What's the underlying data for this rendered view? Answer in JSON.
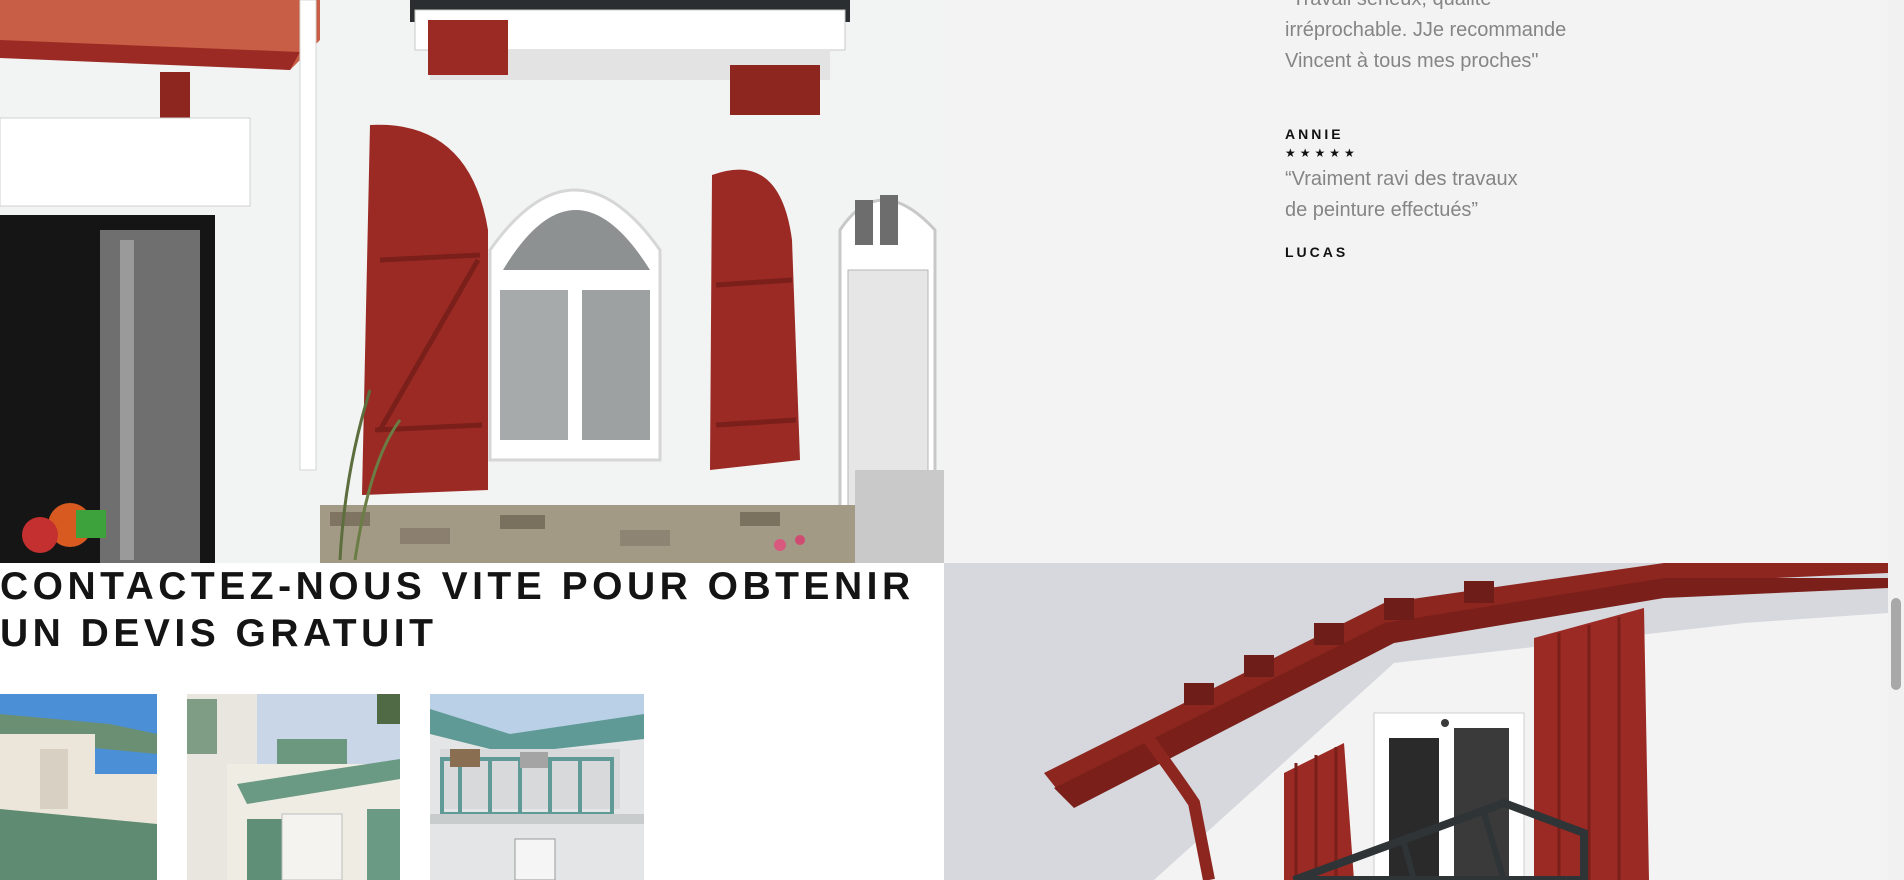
{
  "testimonials": [
    {
      "quote": "\"Travail sérieux, qualité irréprochable. JJe recommande Vincent à tous mes proches\"",
      "author": "ANNIE",
      "stars": "★★★★★"
    },
    {
      "quote": "“Vraiment ravi des travaux de peinture effectués”",
      "author": "LUCAS"
    }
  ],
  "contact": {
    "heading_line1": "CONTACTEZ-NOUS VITE POUR OBTENIR",
    "heading_line2": "UN DEVIS GRATUIT"
  },
  "gallery": {
    "thumbnails": [
      "house-green-roof",
      "house-green-shutters",
      "house-teal-balcony"
    ]
  },
  "colors": {
    "shutter_red": "#9b2a24",
    "panel_bg": "#f3f3f3",
    "heading": "#141414",
    "quote_text": "#858585",
    "teal": "#5f9a96"
  }
}
